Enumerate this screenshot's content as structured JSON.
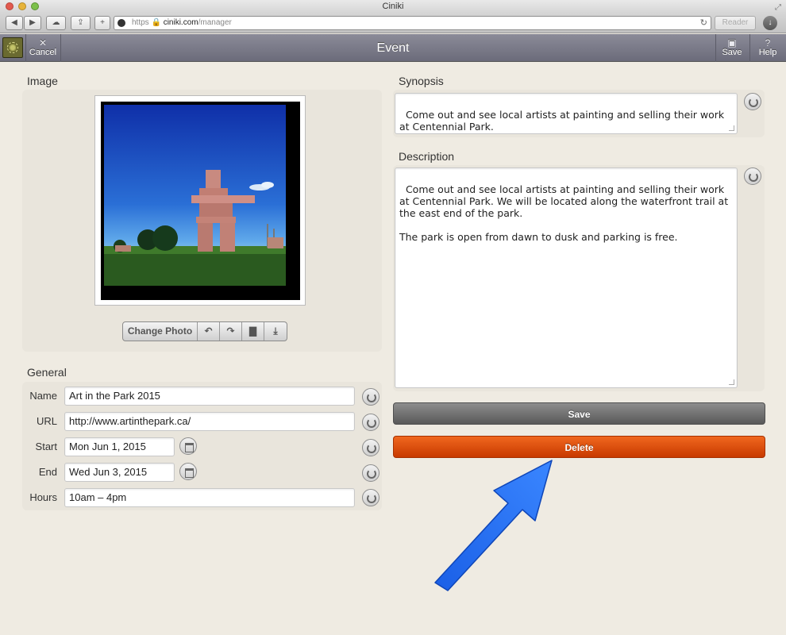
{
  "browser": {
    "window_title": "Ciniki",
    "url_scheme": "https",
    "url_host": "ciniki.com",
    "url_path": "/manager",
    "reader_label": "Reader"
  },
  "header": {
    "title": "Event",
    "cancel_label": "Cancel",
    "save_label": "Save",
    "help_label": "Help",
    "help_glyph": "?"
  },
  "image_section": {
    "label": "Image",
    "toolbar": {
      "change_photo_label": "Change Photo",
      "icons": [
        "rotate-left-icon",
        "rotate-right-icon",
        "trash-icon",
        "download-icon"
      ]
    }
  },
  "general": {
    "label": "General",
    "fields": {
      "name": {
        "label": "Name",
        "value": "Art in the Park 2015"
      },
      "url": {
        "label": "URL",
        "value": "http://www.artinthepark.ca/"
      },
      "start": {
        "label": "Start",
        "value": "Mon Jun 1, 2015"
      },
      "end": {
        "label": "End",
        "value": "Wed Jun 3, 2015"
      },
      "hours": {
        "label": "Hours",
        "value": "10am – 4pm"
      }
    }
  },
  "synopsis": {
    "label": "Synopsis",
    "value": "Come out and see local artists at painting and selling their work at Centennial Park."
  },
  "description": {
    "label": "Description",
    "value": "Come out and see local artists at painting and selling their work at Centennial Park. We will be located along the waterfront trail at the east end of the park.\n\nThe park is open from dawn to dusk and parking is free."
  },
  "actions": {
    "save_label": "Save",
    "delete_label": "Delete"
  },
  "colors": {
    "delete": "#e04f0d",
    "save": "#707070",
    "arrow": "#1f6df0"
  }
}
